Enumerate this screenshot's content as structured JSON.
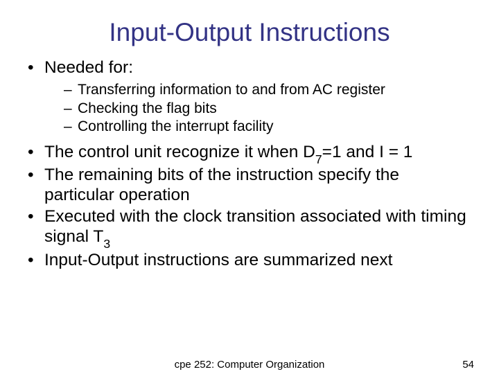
{
  "title": "Input-Output Instructions",
  "bullets": {
    "l1_0": "Needed for:",
    "l2_0": "Transferring information to and from AC register",
    "l2_1": "Checking the flag bits",
    "l2_2": "Controlling the interrupt facility",
    "l1_1a": "The control unit recognize it when D",
    "l1_1s": "7",
    "l1_1b": "=1 and I = 1",
    "l1_2": "The remaining bits of the instruction specify the particular operation",
    "l1_3a": "Executed with the clock transition associated with timing signal T",
    "l1_3s": "3",
    "l1_4": "Input-Output instructions are summarized next"
  },
  "footer": {
    "center": "cpe 252: Computer Organization",
    "page": "54"
  }
}
